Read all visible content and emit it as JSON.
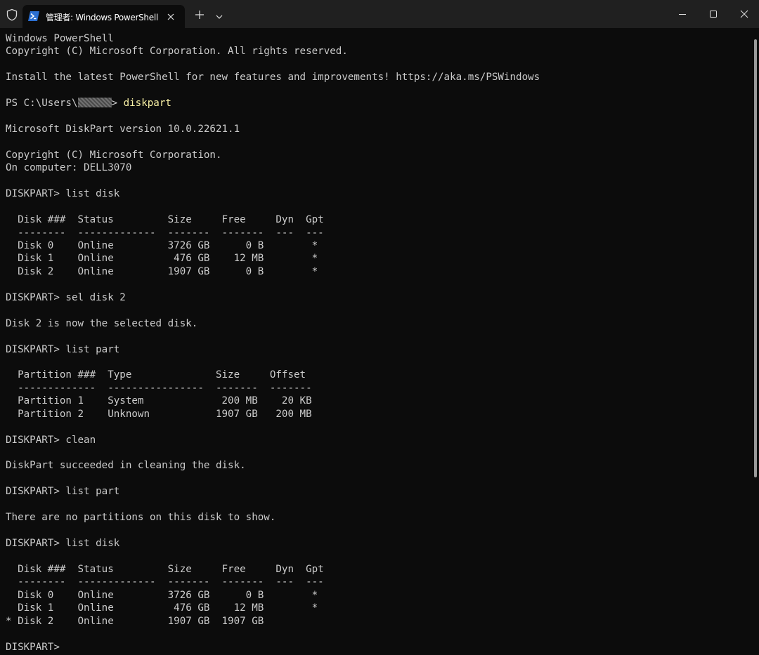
{
  "window": {
    "tab_title": "管理者: Windows PowerShell"
  },
  "terminal": {
    "lines": [
      {
        "text": "Windows PowerShell"
      },
      {
        "text": "Copyright (C) Microsoft Corporation. All rights reserved."
      },
      {
        "text": ""
      },
      {
        "text": "Install the latest PowerShell for new features and improvements! https://aka.ms/PSWindows"
      },
      {
        "text": ""
      },
      {
        "prompt": "PS C:\\Users\\",
        "prompt_end": "> ",
        "command": "diskpart",
        "redacted": true
      },
      {
        "text": ""
      },
      {
        "text": "Microsoft DiskPart version 10.0.22621.1"
      },
      {
        "text": ""
      },
      {
        "text": "Copyright (C) Microsoft Corporation."
      },
      {
        "text": "On computer: DELL3070"
      },
      {
        "text": ""
      },
      {
        "text": "DISKPART> list disk"
      },
      {
        "text": ""
      },
      {
        "text": "  Disk ###  Status         Size     Free     Dyn  Gpt"
      },
      {
        "text": "  --------  -------------  -------  -------  ---  ---"
      },
      {
        "text": "  Disk 0    Online         3726 GB      0 B        *"
      },
      {
        "text": "  Disk 1    Online          476 GB    12 MB        *"
      },
      {
        "text": "  Disk 2    Online         1907 GB      0 B        *"
      },
      {
        "text": ""
      },
      {
        "text": "DISKPART> sel disk 2"
      },
      {
        "text": ""
      },
      {
        "text": "Disk 2 is now the selected disk."
      },
      {
        "text": ""
      },
      {
        "text": "DISKPART> list part"
      },
      {
        "text": ""
      },
      {
        "text": "  Partition ###  Type              Size     Offset"
      },
      {
        "text": "  -------------  ----------------  -------  -------"
      },
      {
        "text": "  Partition 1    System             200 MB    20 KB"
      },
      {
        "text": "  Partition 2    Unknown           1907 GB   200 MB"
      },
      {
        "text": ""
      },
      {
        "text": "DISKPART> clean"
      },
      {
        "text": ""
      },
      {
        "text": "DiskPart succeeded in cleaning the disk."
      },
      {
        "text": ""
      },
      {
        "text": "DISKPART> list part"
      },
      {
        "text": ""
      },
      {
        "text": "There are no partitions on this disk to show."
      },
      {
        "text": ""
      },
      {
        "text": "DISKPART> list disk"
      },
      {
        "text": ""
      },
      {
        "text": "  Disk ###  Status         Size     Free     Dyn  Gpt"
      },
      {
        "text": "  --------  -------------  -------  -------  ---  ---"
      },
      {
        "text": "  Disk 0    Online         3726 GB      0 B        *"
      },
      {
        "text": "  Disk 1    Online          476 GB    12 MB        *"
      },
      {
        "text": "* Disk 2    Online         1907 GB  1907 GB"
      },
      {
        "text": ""
      },
      {
        "text": "DISKPART> "
      }
    ]
  },
  "icons": {
    "admin": "shield-icon",
    "tab": "powershell-icon",
    "close_tab": "close-icon",
    "new_tab": "plus-icon",
    "dropdown": "chevron-down-icon",
    "minimize": "minimize-icon",
    "maximize": "maximize-icon",
    "close_window": "close-icon"
  },
  "colors": {
    "background": "#0c0c0c",
    "titlebar": "#202020",
    "text": "#cccccc",
    "command": "#f9f1a5",
    "tab_icon": "#2b6fd1"
  }
}
